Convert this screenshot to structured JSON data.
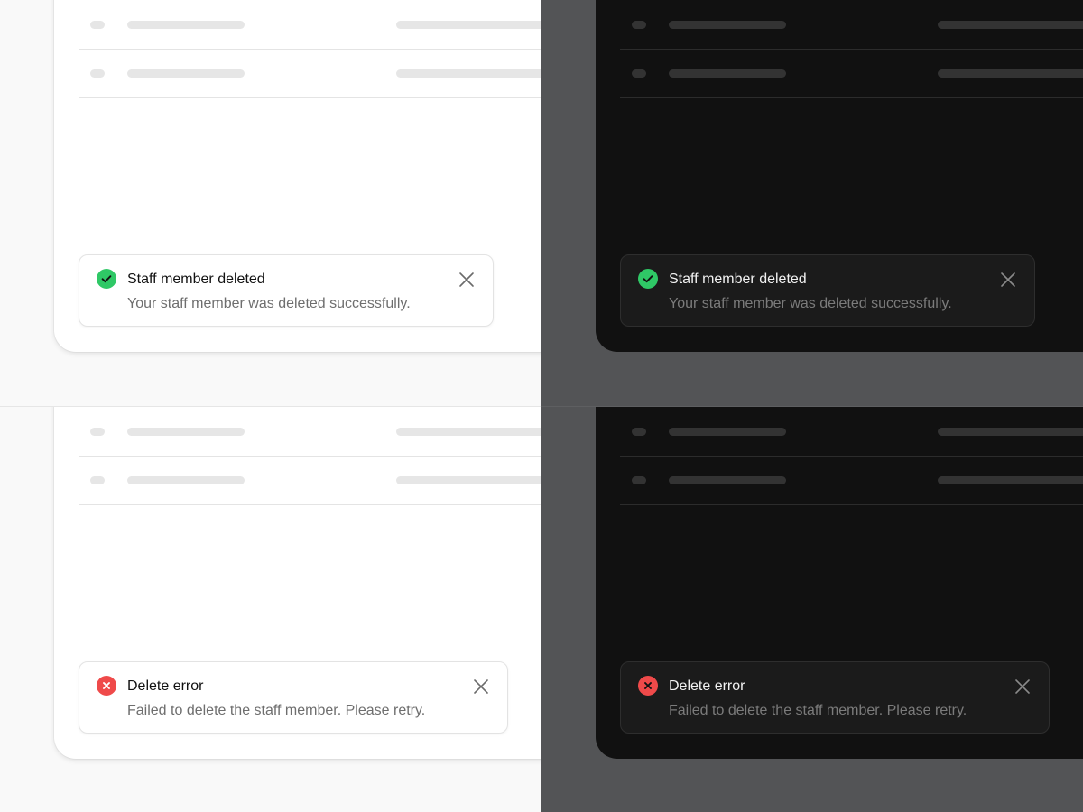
{
  "colors": {
    "success": "#2fc866",
    "error": "#ef4a4a",
    "light_bg": "#f9f9f9",
    "dark_bg": "#535456",
    "dark_card": "#111111"
  },
  "panels": [
    {
      "theme": "light",
      "toast": {
        "variant": "success",
        "icon": "check-circle-icon",
        "title": "Staff member deleted",
        "message": "Your staff member was deleted successfully."
      }
    },
    {
      "theme": "dark",
      "toast": {
        "variant": "success",
        "icon": "check-circle-icon",
        "title": "Staff member deleted",
        "message": "Your staff member was deleted successfully."
      }
    },
    {
      "theme": "light",
      "toast": {
        "variant": "error",
        "icon": "x-circle-icon",
        "title": "Delete error",
        "message": "Failed to delete the staff member. Please retry."
      }
    },
    {
      "theme": "dark",
      "toast": {
        "variant": "error",
        "icon": "x-circle-icon",
        "title": "Delete error",
        "message": "Failed to delete the staff member. Please retry."
      }
    }
  ]
}
